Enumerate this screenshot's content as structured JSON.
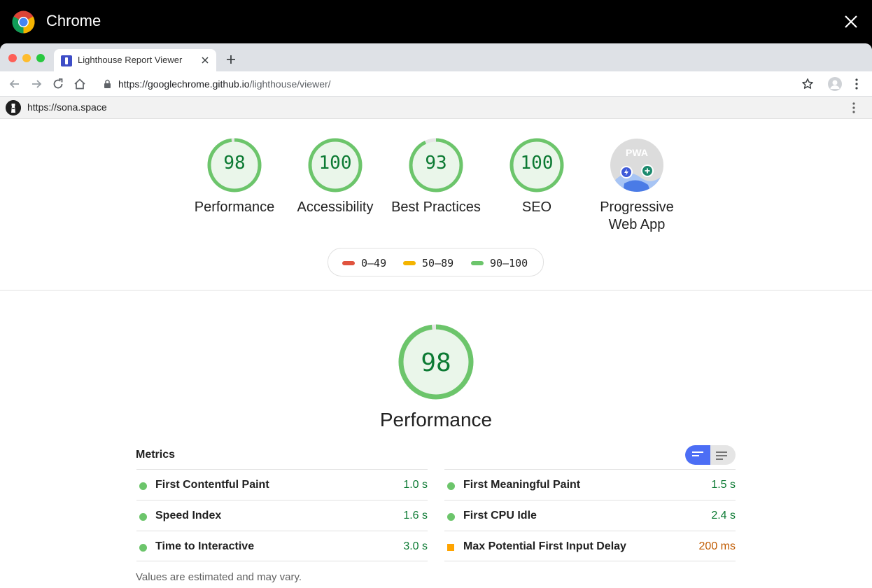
{
  "os": {
    "app_name": "Chrome"
  },
  "browser": {
    "tab": {
      "title": "Lighthouse Report Viewer"
    },
    "url": {
      "host": "https://googlechrome.github.io",
      "path": "/lighthouse/viewer/"
    }
  },
  "report": {
    "site_url": "https://sona.space",
    "categories": [
      {
        "label": "Performance",
        "score": "98",
        "fraction": 0.98
      },
      {
        "label": "Accessibility",
        "score": "100",
        "fraction": 1.0
      },
      {
        "label": "Best Practices",
        "score": "93",
        "fraction": 0.93
      },
      {
        "label": "SEO",
        "score": "100",
        "fraction": 1.0
      }
    ],
    "pwa": {
      "label": "Progressive Web App",
      "badge": "PWA"
    },
    "legend": [
      {
        "range": "0–49",
        "color": "#e0533e"
      },
      {
        "range": "50–89",
        "color": "#f4b400"
      },
      {
        "range": "90–100",
        "color": "#6cc56b"
      }
    ],
    "performance": {
      "score": "98",
      "fraction": 0.98,
      "title": "Performance",
      "metrics_heading": "Metrics",
      "metrics_left": [
        {
          "name": "First Contentful Paint",
          "value": "1.0 s",
          "status": "pass"
        },
        {
          "name": "Speed Index",
          "value": "1.6 s",
          "status": "pass"
        },
        {
          "name": "Time to Interactive",
          "value": "3.0 s",
          "status": "pass"
        }
      ],
      "metrics_right": [
        {
          "name": "First Meaningful Paint",
          "value": "1.5 s",
          "status": "pass"
        },
        {
          "name": "First CPU Idle",
          "value": "2.4 s",
          "status": "pass"
        },
        {
          "name": "Max Potential First Input Delay",
          "value": "200 ms",
          "status": "average"
        }
      ],
      "note": "Values are estimated and may vary."
    }
  },
  "colors": {
    "pass": "#6cc56b",
    "pass_text": "#0c7a33",
    "average": "#ffa400",
    "accent": "#4c6ef5"
  }
}
